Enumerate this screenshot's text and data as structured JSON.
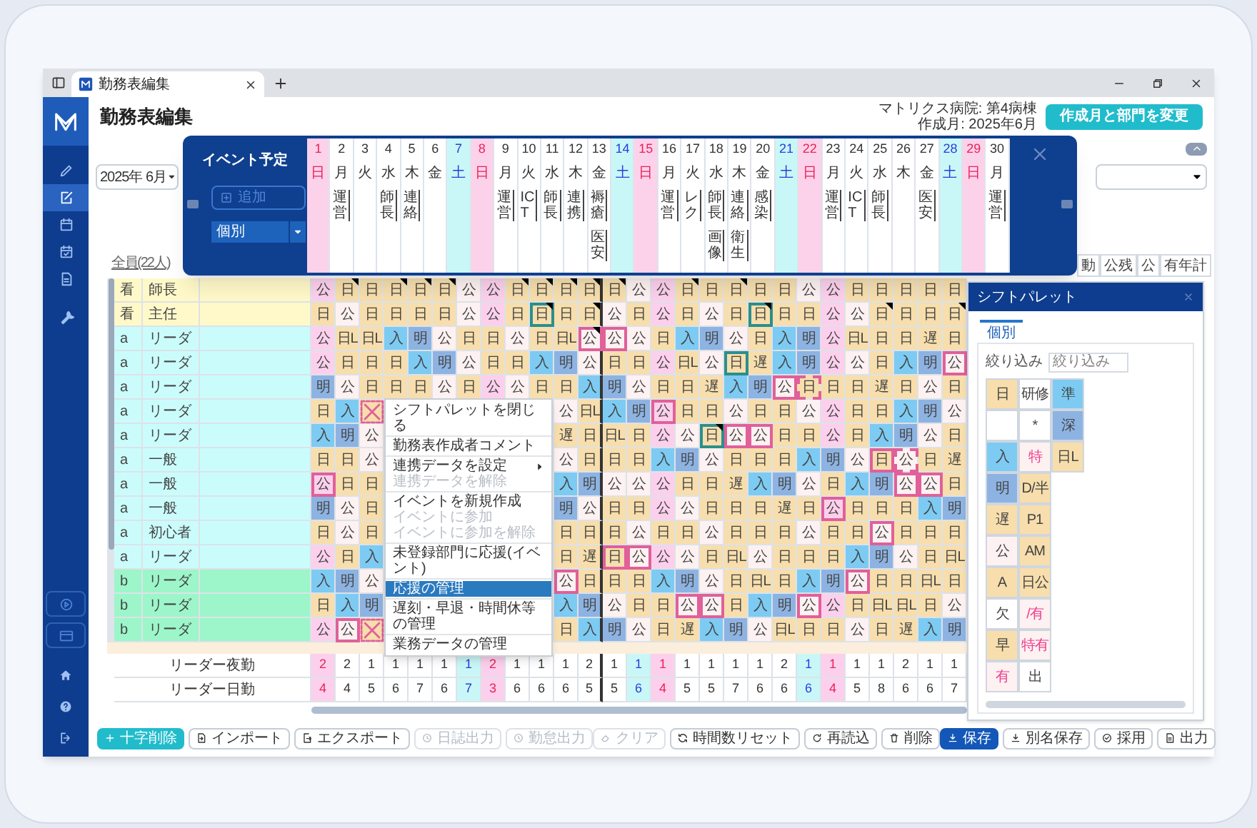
{
  "browser": {
    "tab_title": "勤務表編集"
  },
  "sidebar": {
    "items": [
      {
        "selected": false
      },
      {
        "selected": true
      },
      {
        "selected": false
      },
      {
        "selected": false
      },
      {
        "selected": false
      },
      {
        "selected": false
      }
    ]
  },
  "header": {
    "title": "勤務表編集",
    "hospital": "マトリクス病院: 第4病棟",
    "created_month": "作成月: 2025年6月",
    "change_button": "作成月と部門を変更"
  },
  "month_select": {
    "value": "2025年 6月"
  },
  "staff_link": "全員(22人)",
  "summary_columns": [
    "動",
    "公残",
    "公",
    "有年計"
  ],
  "event_panel": {
    "title": "イベント予定",
    "add_button": {
      "label": "追加",
      "disabled": true
    },
    "filter": {
      "value": "個別"
    },
    "days": [
      {
        "number": "1",
        "weekday": "日",
        "kind": "sun"
      },
      {
        "number": "2",
        "weekday": "月",
        "kind": "weekday",
        "events": [
          "運営"
        ]
      },
      {
        "number": "3",
        "weekday": "火",
        "kind": "weekday"
      },
      {
        "number": "4",
        "weekday": "水",
        "kind": "weekday",
        "events": [
          "師長"
        ]
      },
      {
        "number": "5",
        "weekday": "木",
        "kind": "weekday",
        "events": [
          "連絡"
        ]
      },
      {
        "number": "6",
        "weekday": "金",
        "kind": "weekday"
      },
      {
        "number": "7",
        "weekday": "土",
        "kind": "sat"
      },
      {
        "number": "8",
        "weekday": "日",
        "kind": "sun"
      },
      {
        "number": "9",
        "weekday": "月",
        "kind": "weekday",
        "events": [
          "運営"
        ]
      },
      {
        "number": "10",
        "weekday": "火",
        "kind": "weekday",
        "events": [
          "ICT"
        ]
      },
      {
        "number": "11",
        "weekday": "水",
        "kind": "weekday",
        "events": [
          "師長"
        ]
      },
      {
        "number": "12",
        "weekday": "木",
        "kind": "weekday",
        "events": [
          "連携"
        ]
      },
      {
        "number": "13",
        "weekday": "金",
        "kind": "weekday",
        "events": [
          "褥瘡",
          "医安"
        ]
      },
      {
        "number": "14",
        "weekday": "土",
        "kind": "sat"
      },
      {
        "number": "15",
        "weekday": "日",
        "kind": "sun"
      },
      {
        "number": "16",
        "weekday": "月",
        "kind": "weekday",
        "events": [
          "運営"
        ]
      },
      {
        "number": "17",
        "weekday": "火",
        "kind": "weekday",
        "events": [
          "レク"
        ]
      },
      {
        "number": "18",
        "weekday": "水",
        "kind": "weekday",
        "events": [
          "師長",
          "画像"
        ]
      },
      {
        "number": "19",
        "weekday": "木",
        "kind": "weekday",
        "events": [
          "連絡",
          "衛生"
        ]
      },
      {
        "number": "20",
        "weekday": "金",
        "kind": "weekday",
        "events": [
          "感染"
        ]
      },
      {
        "number": "21",
        "weekday": "土",
        "kind": "sat"
      },
      {
        "number": "22",
        "weekday": "日",
        "kind": "sun"
      },
      {
        "number": "23",
        "weekday": "月",
        "kind": "weekday",
        "events": [
          "運営"
        ]
      },
      {
        "number": "24",
        "weekday": "火",
        "kind": "weekday",
        "events": [
          "ICT"
        ]
      },
      {
        "number": "25",
        "weekday": "水",
        "kind": "weekday",
        "events": [
          "師長"
        ]
      },
      {
        "number": "26",
        "weekday": "木",
        "kind": "weekday"
      },
      {
        "number": "27",
        "weekday": "金",
        "kind": "weekday",
        "events": [
          "医安"
        ]
      },
      {
        "number": "28",
        "weekday": "土",
        "kind": "sat"
      },
      {
        "number": "29",
        "weekday": "日",
        "kind": "sun"
      },
      {
        "number": "30",
        "weekday": "月",
        "kind": "weekday",
        "events": [
          "運営"
        ]
      }
    ]
  },
  "grid": {
    "rows": [
      {
        "group": "看",
        "role": "師長",
        "kind": "senior",
        "cells": [
          {
            "text": "公",
            "kind": "off"
          },
          {
            "text": "日",
            "kind": "day",
            "note": true
          },
          {
            "text": "日",
            "kind": "day"
          },
          {
            "text": "日",
            "kind": "day",
            "note": true
          },
          {
            "text": "日",
            "kind": "day",
            "note": true
          },
          {
            "text": "日",
            "kind": "day",
            "note": true
          },
          {
            "text": "公",
            "kind": "off"
          },
          {
            "text": "公",
            "kind": "off"
          },
          {
            "text": "日",
            "kind": "day",
            "note": true
          },
          {
            "text": "日",
            "kind": "day",
            "note": true
          },
          {
            "text": "日",
            "kind": "day",
            "note": true
          },
          {
            "text": "日",
            "kind": "day",
            "note": true
          },
          {
            "text": "日",
            "kind": "day",
            "note": true
          },
          {
            "text": "公",
            "kind": "off"
          },
          {
            "text": "公",
            "kind": "off"
          },
          {
            "text": "日",
            "kind": "day",
            "note": true
          },
          {
            "text": "日",
            "kind": "day"
          },
          {
            "text": "日",
            "kind": "day",
            "note": true
          },
          {
            "text": "日",
            "kind": "day"
          },
          {
            "text": "日",
            "kind": "day"
          },
          {
            "text": "公",
            "kind": "off"
          },
          {
            "text": "公",
            "kind": "off"
          },
          {
            "text": "日",
            "kind": "day"
          },
          {
            "text": "日",
            "kind": "day"
          },
          {
            "text": "日",
            "kind": "day"
          },
          {
            "text": "日",
            "kind": "day"
          },
          {
            "text": "日",
            "kind": "day"
          }
        ]
      },
      {
        "group": "看",
        "role": "主任",
        "kind": "senior",
        "cells": [
          {
            "text": "日",
            "kind": "day"
          },
          {
            "text": "公",
            "kind": "off"
          },
          {
            "text": "日",
            "kind": "day"
          },
          {
            "text": "日",
            "kind": "day"
          },
          {
            "text": "日",
            "kind": "day"
          },
          {
            "text": "日",
            "kind": "day"
          },
          {
            "text": "公",
            "kind": "off"
          },
          {
            "text": "公",
            "kind": "off"
          },
          {
            "text": "日",
            "kind": "day"
          },
          {
            "text": "日",
            "kind": "day",
            "color": "#2b8f8c",
            "note": true
          },
          {
            "text": "日",
            "kind": "day"
          },
          {
            "text": "日",
            "kind": "day",
            "note": true
          },
          {
            "text": "公",
            "kind": "off"
          },
          {
            "text": "日",
            "kind": "day"
          },
          {
            "text": "公",
            "kind": "off"
          },
          {
            "text": "日",
            "kind": "day"
          },
          {
            "text": "公",
            "kind": "off"
          },
          {
            "text": "日",
            "kind": "day"
          },
          {
            "text": "日",
            "kind": "day",
            "color": "#2b8f8c",
            "note": true
          },
          {
            "text": "日",
            "kind": "day"
          },
          {
            "text": "日",
            "kind": "day"
          },
          {
            "text": "公",
            "kind": "off"
          },
          {
            "text": "公",
            "kind": "off"
          },
          {
            "text": "日",
            "kind": "day",
            "note": true
          },
          {
            "text": "日",
            "kind": "day"
          },
          {
            "text": "日",
            "kind": "day"
          },
          {
            "text": "日",
            "kind": "day",
            "note": true
          }
        ]
      },
      {
        "group": "a",
        "role": "リーダ",
        "kind": "a",
        "cells": [
          {
            "text": "公",
            "kind": "off"
          },
          {
            "text": "日L",
            "kind": "day"
          },
          {
            "text": "日L",
            "kind": "day"
          },
          {
            "text": "入",
            "kind": "in"
          },
          {
            "text": "明",
            "kind": "after"
          },
          {
            "text": "公",
            "kind": "off"
          },
          {
            "text": "日",
            "kind": "day"
          },
          {
            "text": "日",
            "kind": "day"
          },
          {
            "text": "公",
            "kind": "off"
          },
          {
            "text": "日",
            "kind": "day"
          },
          {
            "text": "日L",
            "kind": "day"
          },
          {
            "text": "公",
            "kind": "off",
            "color": "#e0609a",
            "note": true
          },
          {
            "text": "公",
            "kind": "off",
            "color": "#e0609a"
          },
          {
            "text": "公",
            "kind": "off"
          },
          {
            "text": "日",
            "kind": "day"
          },
          {
            "text": "入",
            "kind": "in"
          },
          {
            "text": "明",
            "kind": "after"
          },
          {
            "text": "公",
            "kind": "off"
          },
          {
            "text": "日",
            "kind": "day"
          },
          {
            "text": "入",
            "kind": "in"
          },
          {
            "text": "明",
            "kind": "after"
          },
          {
            "text": "公",
            "kind": "off"
          },
          {
            "text": "日L",
            "kind": "day"
          },
          {
            "text": "日",
            "kind": "day"
          },
          {
            "text": "日",
            "kind": "day"
          },
          {
            "text": "遅",
            "kind": "day"
          },
          {
            "text": "日",
            "kind": "day"
          }
        ]
      },
      {
        "group": "a",
        "role": "リーダ",
        "kind": "a",
        "cells": [
          {
            "text": "公",
            "kind": "off"
          },
          {
            "text": "日",
            "kind": "day"
          },
          {
            "text": "日",
            "kind": "day"
          },
          {
            "text": "日",
            "kind": "day"
          },
          {
            "text": "入",
            "kind": "in"
          },
          {
            "text": "明",
            "kind": "after"
          },
          {
            "text": "公",
            "kind": "off"
          },
          {
            "text": "日",
            "kind": "day"
          },
          {
            "text": "日",
            "kind": "day"
          },
          {
            "text": "入",
            "kind": "in"
          },
          {
            "text": "明",
            "kind": "after"
          },
          {
            "text": "公",
            "kind": "off"
          },
          {
            "text": "日",
            "kind": "day"
          },
          {
            "text": "日",
            "kind": "day"
          },
          {
            "text": "公",
            "kind": "off"
          },
          {
            "text": "日L",
            "kind": "day"
          },
          {
            "text": "公",
            "kind": "off"
          },
          {
            "text": "日",
            "kind": "day",
            "color": "#2b8f8c"
          },
          {
            "text": "遅",
            "kind": "day"
          },
          {
            "text": "入",
            "kind": "in"
          },
          {
            "text": "明",
            "kind": "after"
          },
          {
            "text": "公",
            "kind": "off"
          },
          {
            "text": "公",
            "kind": "off"
          },
          {
            "text": "日",
            "kind": "day"
          },
          {
            "text": "入",
            "kind": "in"
          },
          {
            "text": "明",
            "kind": "after"
          },
          {
            "text": "公",
            "kind": "off",
            "color": "#e0609a"
          }
        ]
      },
      {
        "group": "a",
        "role": "リーダ",
        "kind": "a",
        "cells": [
          {
            "text": "明",
            "kind": "after"
          },
          {
            "text": "公",
            "kind": "off"
          },
          {
            "text": "日",
            "kind": "day"
          },
          {
            "text": "日",
            "kind": "day"
          },
          {
            "text": "日",
            "kind": "day"
          },
          {
            "text": "公",
            "kind": "off"
          },
          {
            "text": "日",
            "kind": "day"
          },
          {
            "text": "公",
            "kind": "off"
          },
          {
            "text": "公",
            "kind": "off"
          },
          {
            "text": "日",
            "kind": "day"
          },
          {
            "text": "日",
            "kind": "day"
          },
          {
            "text": "入",
            "kind": "in"
          },
          {
            "text": "明",
            "kind": "after"
          },
          {
            "text": "公",
            "kind": "off"
          },
          {
            "text": "日",
            "kind": "day"
          },
          {
            "text": "日",
            "kind": "day"
          },
          {
            "text": "遅",
            "kind": "day"
          },
          {
            "text": "入",
            "kind": "in"
          },
          {
            "text": "明",
            "kind": "after"
          },
          {
            "text": "公",
            "kind": "off",
            "color": "#e0609a"
          },
          {
            "text": "日",
            "kind": "day",
            "color": "#e0609a",
            "dashed": true
          },
          {
            "text": "日",
            "kind": "day"
          },
          {
            "text": "日",
            "kind": "day"
          },
          {
            "text": "遅",
            "kind": "day"
          },
          {
            "text": "日",
            "kind": "day"
          },
          {
            "text": "公",
            "kind": "off"
          },
          {
            "text": "日",
            "kind": "day"
          }
        ]
      },
      {
        "group": "a",
        "role": "リーダ",
        "kind": "a",
        "cells": [
          {
            "text": "日",
            "kind": "day"
          },
          {
            "text": "入",
            "kind": "in"
          },
          {
            "kind": "crossed"
          },
          null,
          null,
          null,
          null,
          null,
          null,
          null,
          {
            "text": "公",
            "kind": "off"
          },
          {
            "text": "日L",
            "kind": "day"
          },
          {
            "text": "入",
            "kind": "in"
          },
          {
            "text": "明",
            "kind": "after"
          },
          {
            "text": "公",
            "kind": "off",
            "color": "#e0609a"
          },
          {
            "text": "日",
            "kind": "day"
          },
          {
            "text": "日",
            "kind": "day"
          },
          {
            "text": "公",
            "kind": "off"
          },
          {
            "text": "日",
            "kind": "day"
          },
          {
            "text": "日",
            "kind": "day"
          },
          {
            "text": "公",
            "kind": "off"
          },
          {
            "text": "公",
            "kind": "off"
          },
          {
            "text": "日",
            "kind": "day"
          },
          {
            "text": "日",
            "kind": "day"
          },
          {
            "text": "入",
            "kind": "in"
          },
          {
            "text": "明",
            "kind": "after"
          },
          {
            "text": "公",
            "kind": "off"
          }
        ]
      },
      {
        "group": "a",
        "role": "リーダ",
        "kind": "a",
        "cells": [
          {
            "text": "入",
            "kind": "in"
          },
          {
            "text": "明",
            "kind": "after"
          },
          {
            "text": "公",
            "kind": "off"
          },
          null,
          null,
          null,
          null,
          null,
          null,
          null,
          {
            "text": "遅",
            "kind": "day"
          },
          {
            "text": "日",
            "kind": "day"
          },
          {
            "text": "日L",
            "kind": "day"
          },
          {
            "text": "日",
            "kind": "day"
          },
          {
            "text": "公",
            "kind": "off"
          },
          {
            "text": "公",
            "kind": "off"
          },
          {
            "text": "日",
            "kind": "day",
            "color": "#2b8f8c",
            "note": true
          },
          {
            "text": "公",
            "kind": "off",
            "color": "#e0609a"
          },
          {
            "text": "公",
            "kind": "off",
            "color": "#e0609a"
          },
          {
            "text": "日",
            "kind": "day"
          },
          {
            "text": "日",
            "kind": "day"
          },
          {
            "text": "公",
            "kind": "off"
          },
          {
            "text": "日",
            "kind": "day"
          },
          {
            "text": "入",
            "kind": "in"
          },
          {
            "text": "明",
            "kind": "after"
          },
          {
            "text": "公",
            "kind": "off"
          },
          {
            "text": "日",
            "kind": "day"
          }
        ]
      },
      {
        "group": "a",
        "role": "一般",
        "kind": "a",
        "cells": [
          {
            "text": "日",
            "kind": "day"
          },
          {
            "text": "日",
            "kind": "day"
          },
          {
            "text": "公",
            "kind": "off"
          },
          null,
          null,
          null,
          null,
          null,
          null,
          null,
          {
            "text": "公",
            "kind": "off"
          },
          {
            "text": "日",
            "kind": "day"
          },
          {
            "text": "日",
            "kind": "day"
          },
          {
            "text": "日",
            "kind": "day"
          },
          {
            "text": "入",
            "kind": "in"
          },
          {
            "text": "明",
            "kind": "after"
          },
          {
            "text": "公",
            "kind": "off"
          },
          {
            "text": "日",
            "kind": "day"
          },
          {
            "text": "日",
            "kind": "day"
          },
          {
            "text": "日",
            "kind": "day"
          },
          {
            "text": "入",
            "kind": "in"
          },
          {
            "text": "明",
            "kind": "after"
          },
          {
            "text": "公",
            "kind": "off"
          },
          {
            "text": "日",
            "kind": "day",
            "color": "#e0609a"
          },
          {
            "text": "公",
            "kind": "off",
            "color": "#e0609a",
            "dashed": true
          },
          {
            "text": "日",
            "kind": "day"
          },
          {
            "text": "遅",
            "kind": "day"
          }
        ]
      },
      {
        "group": "a",
        "role": "一般",
        "kind": "a",
        "cells": [
          {
            "text": "公",
            "kind": "off",
            "color": "#e0609a"
          },
          {
            "text": "日",
            "kind": "day"
          },
          {
            "text": "日",
            "kind": "day"
          },
          null,
          null,
          null,
          null,
          null,
          null,
          null,
          {
            "text": "入",
            "kind": "in"
          },
          {
            "text": "明",
            "kind": "after"
          },
          {
            "text": "公",
            "kind": "off"
          },
          {
            "text": "公",
            "kind": "off"
          },
          {
            "text": "公",
            "kind": "off"
          },
          {
            "text": "日",
            "kind": "day"
          },
          {
            "text": "日",
            "kind": "day"
          },
          {
            "text": "遅",
            "kind": "day"
          },
          {
            "text": "入",
            "kind": "in"
          },
          {
            "text": "明",
            "kind": "after"
          },
          {
            "text": "公",
            "kind": "off"
          },
          {
            "text": "日",
            "kind": "day"
          },
          {
            "text": "入",
            "kind": "in"
          },
          {
            "text": "明",
            "kind": "after"
          },
          {
            "text": "公",
            "kind": "off",
            "color": "#e0609a"
          },
          {
            "text": "公",
            "kind": "off",
            "color": "#e0609a"
          },
          {
            "text": "日",
            "kind": "day"
          }
        ]
      },
      {
        "group": "a",
        "role": "一般",
        "kind": "a",
        "cells": [
          {
            "text": "明",
            "kind": "after"
          },
          {
            "text": "公",
            "kind": "off"
          },
          {
            "text": "日",
            "kind": "day"
          },
          null,
          null,
          null,
          null,
          null,
          null,
          null,
          {
            "text": "明",
            "kind": "after"
          },
          {
            "text": "公",
            "kind": "off"
          },
          {
            "text": "日",
            "kind": "day"
          },
          {
            "text": "日",
            "kind": "day"
          },
          {
            "text": "公",
            "kind": "off"
          },
          {
            "text": "公",
            "kind": "off"
          },
          {
            "text": "日",
            "kind": "day"
          },
          {
            "text": "日",
            "kind": "day"
          },
          {
            "text": "日",
            "kind": "day"
          },
          {
            "text": "遅",
            "kind": "day"
          },
          {
            "text": "日",
            "kind": "day"
          },
          {
            "text": "公",
            "kind": "off",
            "color": "#e0609a"
          },
          {
            "text": "日",
            "kind": "day"
          },
          {
            "text": "日",
            "kind": "day"
          },
          {
            "text": "日",
            "kind": "day"
          },
          {
            "text": "入",
            "kind": "in"
          },
          {
            "text": "明",
            "kind": "after"
          }
        ]
      },
      {
        "group": "a",
        "role": "初心者",
        "kind": "a",
        "cells": [
          {
            "text": "日",
            "kind": "day"
          },
          {
            "text": "公",
            "kind": "off"
          },
          {
            "text": "日",
            "kind": "day"
          },
          null,
          null,
          null,
          null,
          null,
          null,
          null,
          {
            "text": "日",
            "kind": "day"
          },
          {
            "text": "日",
            "kind": "day"
          },
          {
            "text": "日",
            "kind": "day"
          },
          {
            "text": "公",
            "kind": "off"
          },
          {
            "text": "日",
            "kind": "day"
          },
          {
            "text": "日",
            "kind": "day"
          },
          {
            "text": "公",
            "kind": "off"
          },
          {
            "text": "日",
            "kind": "day"
          },
          {
            "text": "日",
            "kind": "day"
          },
          {
            "text": "日",
            "kind": "day"
          },
          {
            "text": "公",
            "kind": "off"
          },
          {
            "text": "日",
            "kind": "day"
          },
          {
            "text": "日",
            "kind": "day"
          },
          {
            "text": "公",
            "kind": "off",
            "color": "#e0609a"
          },
          {
            "text": "日",
            "kind": "day"
          },
          {
            "text": "日",
            "kind": "day"
          },
          {
            "text": "日",
            "kind": "day"
          }
        ]
      },
      {
        "group": "a",
        "role": "リーダ",
        "kind": "a",
        "cells": [
          {
            "text": "公",
            "kind": "off"
          },
          {
            "text": "日",
            "kind": "day"
          },
          {
            "text": "入",
            "kind": "in"
          },
          null,
          null,
          null,
          null,
          null,
          null,
          null,
          {
            "text": "日",
            "kind": "day"
          },
          {
            "text": "遅",
            "kind": "day"
          },
          {
            "text": "日",
            "kind": "day",
            "color": "#e0609a"
          },
          {
            "text": "公",
            "kind": "off",
            "color": "#e0609a"
          },
          {
            "text": "公",
            "kind": "off"
          },
          {
            "text": "公",
            "kind": "off"
          },
          {
            "text": "日",
            "kind": "day"
          },
          {
            "text": "日L",
            "kind": "day"
          },
          {
            "text": "公",
            "kind": "off"
          },
          {
            "text": "日",
            "kind": "day"
          },
          {
            "text": "日",
            "kind": "day"
          },
          {
            "text": "日",
            "kind": "day"
          },
          {
            "text": "入",
            "kind": "in"
          },
          {
            "text": "明",
            "kind": "after"
          },
          {
            "text": "公",
            "kind": "off"
          },
          {
            "text": "日",
            "kind": "day"
          },
          {
            "text": "日L",
            "kind": "day"
          }
        ]
      },
      {
        "group": "b",
        "role": "リーダ",
        "kind": "b",
        "cells": [
          {
            "text": "入",
            "kind": "in"
          },
          {
            "text": "明",
            "kind": "after"
          },
          {
            "text": "公",
            "kind": "off"
          },
          null,
          null,
          null,
          null,
          null,
          null,
          null,
          {
            "text": "公",
            "kind": "off",
            "color": "#e0609a"
          },
          {
            "text": "日",
            "kind": "day"
          },
          {
            "text": "日",
            "kind": "day"
          },
          {
            "text": "日",
            "kind": "day"
          },
          {
            "text": "入",
            "kind": "in"
          },
          {
            "text": "明",
            "kind": "after"
          },
          {
            "text": "公",
            "kind": "off"
          },
          {
            "text": "日",
            "kind": "day"
          },
          {
            "text": "日L",
            "kind": "day"
          },
          {
            "text": "日",
            "kind": "day"
          },
          {
            "text": "入",
            "kind": "in"
          },
          {
            "text": "明",
            "kind": "after"
          },
          {
            "text": "公",
            "kind": "off",
            "color": "#e0609a"
          },
          {
            "text": "日",
            "kind": "day"
          },
          {
            "text": "日",
            "kind": "day"
          },
          {
            "text": "日L",
            "kind": "day"
          },
          {
            "text": "日",
            "kind": "day"
          }
        ]
      },
      {
        "group": "b",
        "role": "リーダ",
        "kind": "b",
        "cells": [
          {
            "text": "日",
            "kind": "day"
          },
          {
            "text": "入",
            "kind": "in"
          },
          {
            "text": "明",
            "kind": "after"
          },
          null,
          null,
          null,
          null,
          null,
          null,
          null,
          {
            "text": "入",
            "kind": "in"
          },
          {
            "text": "明",
            "kind": "after"
          },
          {
            "text": "公",
            "kind": "off"
          },
          {
            "text": "日",
            "kind": "day"
          },
          {
            "text": "日",
            "kind": "day"
          },
          {
            "text": "公",
            "kind": "off",
            "color": "#e0609a"
          },
          {
            "text": "公",
            "kind": "off",
            "color": "#e0609a"
          },
          {
            "text": "日",
            "kind": "day"
          },
          {
            "text": "入",
            "kind": "in"
          },
          {
            "text": "明",
            "kind": "after"
          },
          {
            "text": "公",
            "kind": "off",
            "color": "#e0609a"
          },
          {
            "text": "公",
            "kind": "off"
          },
          {
            "text": "日",
            "kind": "day"
          },
          {
            "text": "日L",
            "kind": "day"
          },
          {
            "text": "日L",
            "kind": "day"
          },
          {
            "text": "日",
            "kind": "day"
          },
          {
            "text": "公",
            "kind": "off"
          }
        ]
      },
      {
        "group": "b",
        "role": "リーダ",
        "kind": "b",
        "cells": [
          {
            "text": "公",
            "kind": "off"
          },
          {
            "text": "公",
            "kind": "off",
            "color": "#e0609a"
          },
          {
            "kind": "crossed"
          },
          null,
          null,
          null,
          null,
          null,
          null,
          null,
          {
            "text": "日",
            "kind": "day"
          },
          {
            "text": "入",
            "kind": "in"
          },
          {
            "text": "明",
            "kind": "after"
          },
          {
            "text": "公",
            "kind": "off"
          },
          {
            "text": "日",
            "kind": "day"
          },
          {
            "text": "遅",
            "kind": "day"
          },
          {
            "text": "入",
            "kind": "in"
          },
          {
            "text": "明",
            "kind": "after"
          },
          {
            "text": "公",
            "kind": "off"
          },
          {
            "text": "日L",
            "kind": "day"
          },
          {
            "text": "日",
            "kind": "day"
          },
          {
            "text": "日",
            "kind": "day"
          },
          {
            "text": "公",
            "kind": "off"
          },
          {
            "text": "日",
            "kind": "day"
          },
          {
            "text": "遅",
            "kind": "day"
          },
          {
            "text": "入",
            "kind": "in"
          },
          {
            "text": "明",
            "kind": "after"
          }
        ]
      }
    ],
    "summary": [
      {
        "label": "リーダー夜勤",
        "values": [
          "2",
          "2",
          "1",
          "1",
          "1",
          "1",
          "1",
          "2",
          "1",
          "1",
          "1",
          "2",
          "1",
          "1",
          "1",
          "1",
          "1",
          "1",
          "1",
          "2",
          "1",
          "1",
          "1",
          "1",
          "2",
          "1",
          "1"
        ]
      },
      {
        "label": "リーダー日勤",
        "values": [
          "4",
          "4",
          "5",
          "6",
          "7",
          "6",
          "7",
          "3",
          "6",
          "6",
          "6",
          "5",
          "5",
          "6",
          "4",
          "5",
          "5",
          "7",
          "6",
          "6",
          "6",
          "4",
          "5",
          "8",
          "6",
          "6",
          "7"
        ]
      }
    ]
  },
  "context_menu": {
    "groups": [
      [
        {
          "label": "シフトパレットを閉じる",
          "disabled": false,
          "selected": false
        }
      ],
      [
        {
          "label": "勤務表作成者コメント",
          "disabled": false,
          "selected": false
        }
      ],
      [
        {
          "label": "連携データを設定",
          "disabled": false,
          "selected": false,
          "submenu": true
        },
        {
          "label": "連携データを解除",
          "disabled": true,
          "selected": false
        }
      ],
      [
        {
          "label": "イベントを新規作成",
          "disabled": false,
          "selected": false
        },
        {
          "label": "イベントに参加",
          "disabled": true,
          "selected": false
        },
        {
          "label": "イベントに参加を解除",
          "disabled": true,
          "selected": false
        }
      ],
      [
        {
          "label": "未登録部門に応援(イベント)",
          "disabled": false,
          "selected": false
        }
      ],
      [
        {
          "label": "応援の管理",
          "disabled": false,
          "selected": true
        }
      ],
      [
        {
          "label": "遅刻・早退・時間休等の管理",
          "disabled": false,
          "selected": false
        }
      ],
      [
        {
          "label": "業務データの管理",
          "disabled": false,
          "selected": false
        }
      ]
    ]
  },
  "palette": {
    "title": "シフトパレット",
    "tabs": [
      {
        "label": "個別",
        "selected": true
      }
    ],
    "filter": {
      "label": "絞り込み",
      "placeholder": "絞り込み"
    },
    "rows": [
      [
        {
          "text": "日",
          "kind": "day"
        },
        {
          "text": "研修",
          "kind": "plain"
        },
        {
          "text": "準",
          "kind": "in"
        }
      ],
      [
        {
          "kind": "blank"
        },
        {
          "text": "*",
          "kind": "plain"
        },
        {
          "text": "深",
          "kind": "after"
        }
      ],
      [
        {
          "text": "入",
          "kind": "in"
        },
        {
          "text": "特",
          "kind": "special"
        },
        {
          "text": "日L",
          "kind": "day"
        }
      ],
      [
        {
          "text": "明",
          "kind": "after"
        },
        {
          "text": "D/半",
          "kind": "day"
        }
      ],
      [
        {
          "text": "遅",
          "kind": "day"
        },
        {
          "text": "P1",
          "kind": "day"
        }
      ],
      [
        {
          "text": "公",
          "kind": "off"
        },
        {
          "text": "AM",
          "kind": "day"
        }
      ],
      [
        {
          "text": "A",
          "kind": "day"
        },
        {
          "text": "日公",
          "kind": "day"
        }
      ],
      [
        {
          "text": "欠",
          "kind": "plain"
        },
        {
          "text": "/有",
          "kind": "special"
        }
      ],
      [
        {
          "text": "早",
          "kind": "day"
        },
        {
          "text": "特有",
          "kind": "special"
        }
      ],
      [
        {
          "text": "有",
          "kind": "special"
        },
        {
          "text": "出",
          "kind": "plain"
        }
      ]
    ]
  },
  "footer": {
    "left": [
      {
        "label": "十字削除",
        "kind": "accent",
        "disabled": false
      },
      {
        "label": "インポート",
        "kind": "normal",
        "disabled": false
      },
      {
        "label": "エクスポート",
        "kind": "normal",
        "disabled": false
      },
      {
        "label": "日誌出力",
        "kind": "normal",
        "disabled": true
      },
      {
        "label": "勤怠出力",
        "kind": "normal",
        "disabled": true
      }
    ],
    "middle": [
      {
        "label": "クリア",
        "kind": "normal",
        "disabled": true
      },
      {
        "label": "時間数リセット",
        "kind": "normal",
        "disabled": false
      },
      {
        "label": "再読込",
        "kind": "normal",
        "disabled": false
      },
      {
        "label": "削除",
        "kind": "normal",
        "disabled": false
      }
    ],
    "right": [
      {
        "label": "保存",
        "kind": "primary",
        "disabled": false
      },
      {
        "label": "別名保存",
        "kind": "normal",
        "disabled": false
      },
      {
        "label": "採用",
        "kind": "normal",
        "disabled": false
      },
      {
        "label": "出力",
        "kind": "normal",
        "disabled": false
      }
    ]
  }
}
